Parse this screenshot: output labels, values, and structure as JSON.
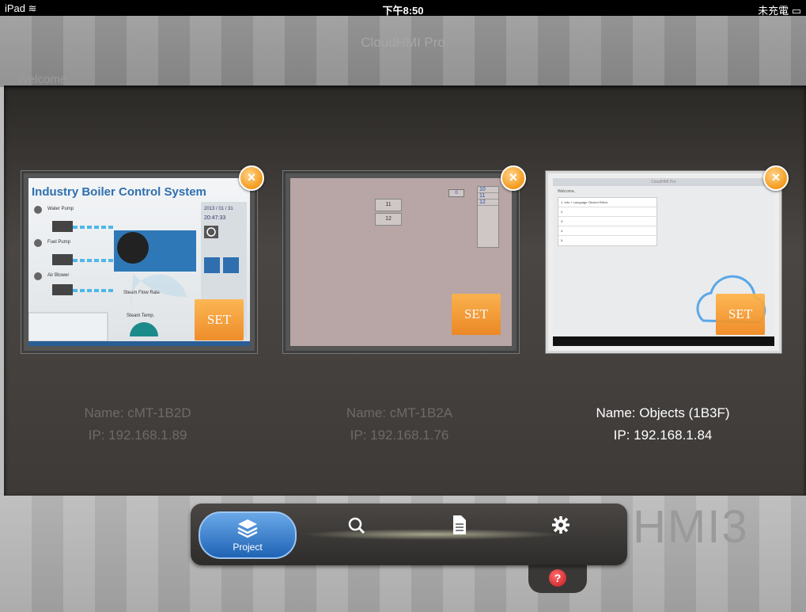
{
  "status_bar": {
    "device": "iPad",
    "time": "下午8:50",
    "battery": "未充電"
  },
  "background": {
    "app_title": "CloudHMI Pro",
    "welcome": "Welcome,"
  },
  "devices": [
    {
      "name": "Name: cMT-1B2D",
      "ip": "IP: 192.168.1.89",
      "set_label": "SET",
      "close_label": "×",
      "preview": {
        "title": "Industry Boiler Control System",
        "date": "2013 / 01 / 31",
        "clock": "20:47:33",
        "labels": [
          "Water Pump",
          "Fuel Pump",
          "Air Blower",
          "Steam Flow Rate",
          "Steam Temp."
        ]
      }
    },
    {
      "name": "Name: cMT-1B2A",
      "ip": "IP: 192.168.1.76",
      "set_label": "SET",
      "close_label": "×",
      "preview": {
        "fields_left": [
          "11",
          "12"
        ],
        "fields_right": [
          "10",
          "11",
          "12"
        ],
        "field_top": "0"
      }
    },
    {
      "name": "Name: Objects (1B3F)",
      "ip": "IP: 192.168.1.84",
      "set_label": "SET",
      "close_label": "×",
      "preview": {
        "header": "CloudHMI Pro",
        "welcome": "Welcome,",
        "items": [
          "1. Info + Language Clicked Effect",
          "2.",
          "3.",
          "4.",
          "5."
        ]
      }
    }
  ],
  "tabbar": {
    "tabs": [
      {
        "label": "Project",
        "icon": "stack-icon",
        "active": true
      },
      {
        "label": "",
        "icon": "search-icon",
        "active": false
      },
      {
        "label": "",
        "icon": "document-icon",
        "active": false
      },
      {
        "label": "",
        "icon": "gear-icon",
        "active": false
      }
    ],
    "help": "?"
  },
  "watermark": "HMI3"
}
